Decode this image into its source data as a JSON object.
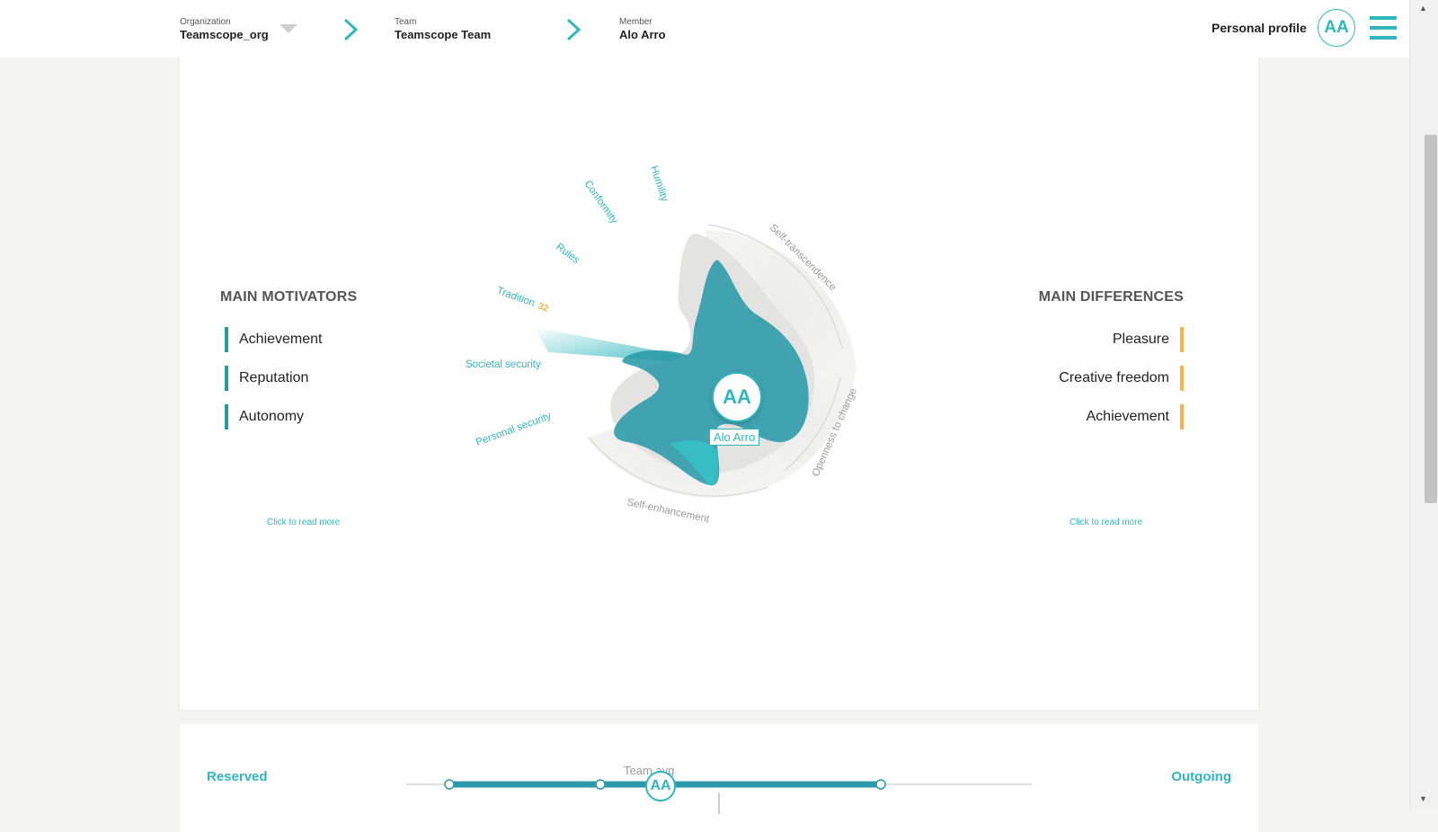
{
  "breadcrumb": {
    "organization": {
      "label": "Organization",
      "value": "Teamscope_org"
    },
    "team": {
      "label": "Team",
      "value": "Teamscope Team"
    },
    "member": {
      "label": "Member",
      "value": "Alo Arro"
    }
  },
  "header": {
    "personal_profile": "Personal profile",
    "avatar_initials": "AA"
  },
  "main_motivators": {
    "title": "MAIN MOTIVATORS",
    "items": [
      "Achievement",
      "Reputation",
      "Autonomy"
    ],
    "read_more": "Click to read more"
  },
  "main_differences": {
    "title": "MAIN DIFFERENCES",
    "items": [
      "Pleasure",
      "Creative freedom",
      "Achievement"
    ],
    "read_more": "Click to read more"
  },
  "chart": {
    "center_initials": "AA",
    "member_name": "Alo Arro",
    "value_labels": [
      "Humility",
      "Conformity",
      "Rules",
      "Tradition",
      "Societal security",
      "Personal security"
    ],
    "highlight_value": "32",
    "group_labels": [
      "Self-transcendence",
      "Openness to change",
      "Self-enhancement"
    ]
  },
  "trait_slider": {
    "left_label": "Reserved",
    "right_label": "Outgoing",
    "marker_label": "Team avg",
    "avatar_initials": "AA"
  },
  "colors": {
    "accent": "#2fb7bd",
    "shape": "#2a9aa8",
    "difference": "#f5b34d"
  }
}
